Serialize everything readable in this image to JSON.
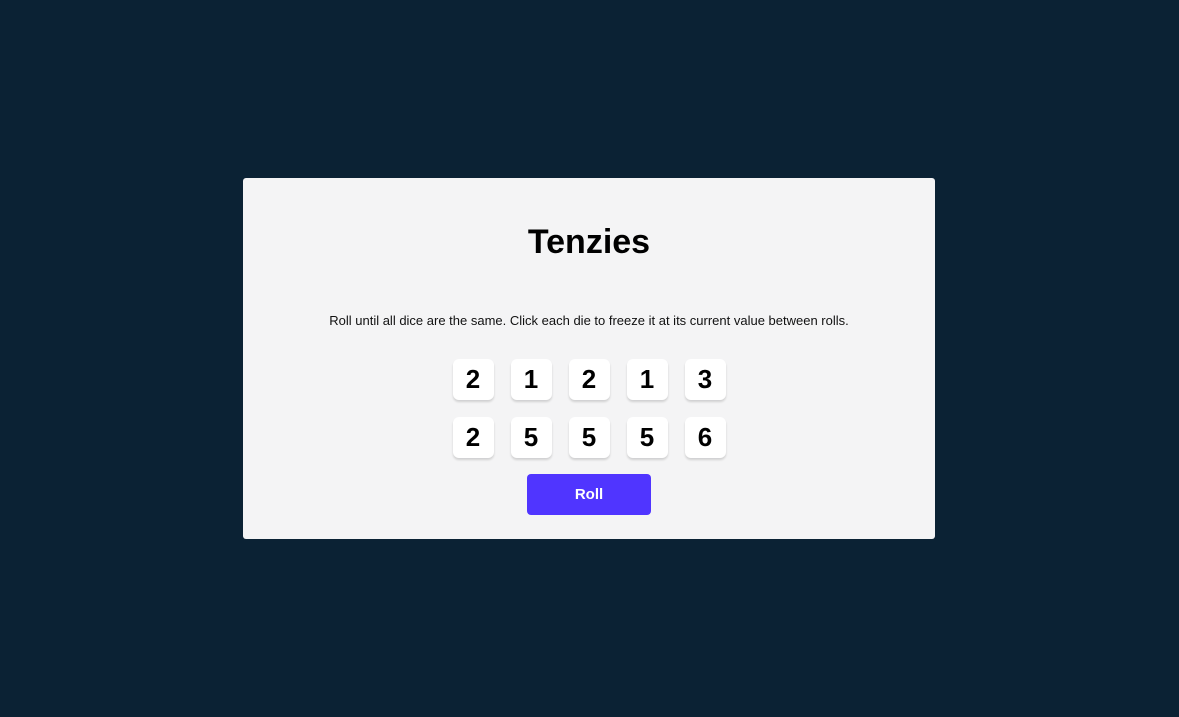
{
  "game": {
    "title": "Tenzies",
    "instructions": "Roll until all dice are the same. Click each die to freeze it at its current value between rolls.",
    "dice": [
      "2",
      "1",
      "2",
      "1",
      "3",
      "2",
      "5",
      "5",
      "5",
      "6"
    ],
    "roll_label": "Roll"
  },
  "colors": {
    "background": "#0b2234",
    "card": "#f4f4f5",
    "die": "#ffffff",
    "accent": "#5035ff"
  }
}
